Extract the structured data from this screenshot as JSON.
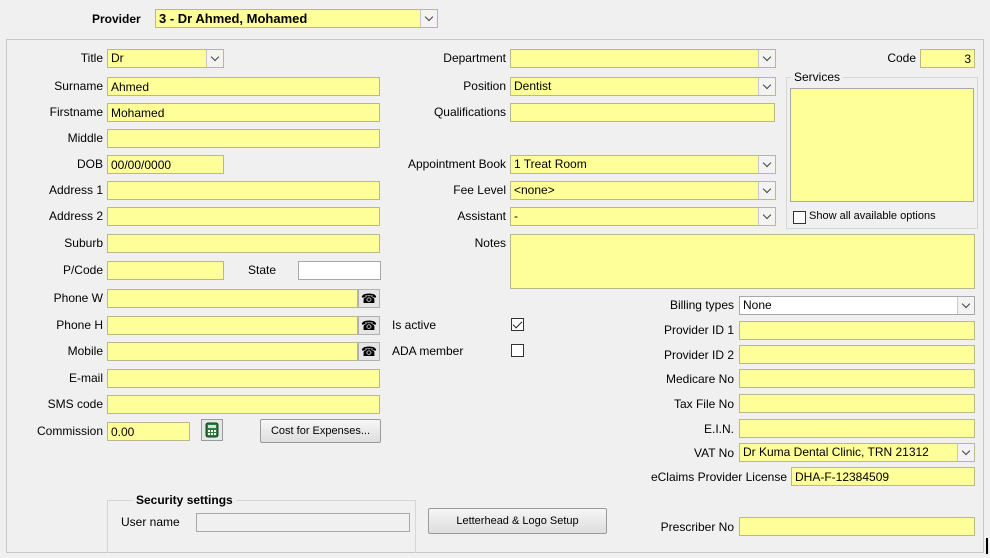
{
  "provider": {
    "label": "Provider",
    "value": "3 - Dr Ahmed, Mohamed"
  },
  "personal": {
    "title_label": "Title",
    "title_value": "Dr",
    "surname_label": "Surname",
    "surname_value": "Ahmed",
    "firstname_label": "Firstname",
    "firstname_value": "Mohamed",
    "middle_label": "Middle",
    "middle_value": "",
    "dob_label": "DOB",
    "dob_value": "00/00/0000",
    "address1_label": "Address 1",
    "address1_value": "",
    "address2_label": "Address 2",
    "address2_value": "",
    "suburb_label": "Suburb",
    "suburb_value": "",
    "pcode_label": "P/Code",
    "pcode_value": "",
    "state_label": "State",
    "state_value": "",
    "phonew_label": "Phone W",
    "phonew_value": "",
    "phoneh_label": "Phone H",
    "phoneh_value": "",
    "mobile_label": "Mobile",
    "mobile_value": "",
    "email_label": "E-mail",
    "email_value": "",
    "sms_label": "SMS code",
    "sms_value": "",
    "commission_label": "Commission",
    "commission_value": "0.00",
    "cost_button": "Cost for Expenses..."
  },
  "work": {
    "department_label": "Department",
    "department_value": "",
    "position_label": "Position",
    "position_value": "Dentist",
    "qualifications_label": "Qualifications",
    "qualifications_value": "",
    "appointment_label": "Appointment Book",
    "appointment_value": "1 Treat Room",
    "fee_label": "Fee Level",
    "fee_value": "<none>",
    "assistant_label": "Assistant",
    "assistant_value": "-",
    "notes_label": "Notes",
    "notes_value": "",
    "is_active_label": "Is active",
    "is_active_checked": true,
    "ada_label": "ADA member",
    "ada_checked": false
  },
  "code": {
    "label": "Code",
    "value": "3"
  },
  "services": {
    "label": "Services",
    "show_all_label": "Show all available options"
  },
  "billing": {
    "billing_label": "Billing types",
    "billing_value": "None",
    "pid1_label": "Provider ID 1",
    "pid1_value": "",
    "pid2_label": "Provider ID 2",
    "pid2_value": "",
    "medicare_label": "Medicare No",
    "medicare_value": "",
    "tax_label": "Tax File No",
    "tax_value": "",
    "ein_label": "E.I.N.",
    "ein_value": "",
    "vat_label": "VAT No",
    "vat_value": "Dr Kuma Dental Clinic, TRN 21312",
    "eclaims_label": "eClaims Provider License",
    "eclaims_value": "DHA-F-12384509",
    "prescriber_label": "Prescriber No",
    "prescriber_value": ""
  },
  "security": {
    "title": "Security settings",
    "username_label": "User name",
    "username_value": ""
  },
  "letterhead_button": "Letterhead & Logo Setup",
  "icons": {
    "phone": "telephone-icon",
    "calculator": "calculator-icon"
  },
  "colors": {
    "field_bg": "#ffff99",
    "window_bg": "#f0f0f0"
  }
}
